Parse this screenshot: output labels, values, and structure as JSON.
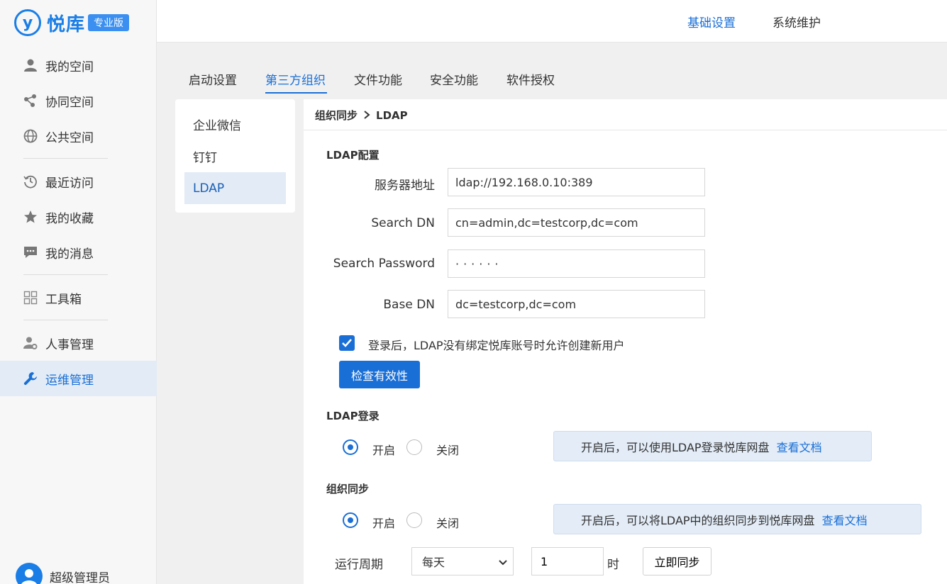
{
  "app": {
    "logo_mark": "y",
    "name": "悦库",
    "edition": "专业版"
  },
  "sidebar": {
    "items": [
      {
        "label": "我的空间",
        "icon": "user-icon"
      },
      {
        "label": "协同空间",
        "icon": "share-icon"
      },
      {
        "label": "公共空间",
        "icon": "globe-icon"
      },
      {
        "label": "最近访问",
        "icon": "history-icon"
      },
      {
        "label": "我的收藏",
        "icon": "star-icon"
      },
      {
        "label": "我的消息",
        "icon": "message-icon"
      },
      {
        "label": "工具箱",
        "icon": "grid-icon"
      },
      {
        "label": "人事管理",
        "icon": "user-gear-icon"
      },
      {
        "label": "运维管理",
        "icon": "wrench-icon"
      }
    ],
    "active_index": 8,
    "user": {
      "name": "超级管理员"
    }
  },
  "header": {
    "tabs": [
      "基础设置",
      "系统维护"
    ],
    "active_index": 0
  },
  "tabs": {
    "items": [
      "启动设置",
      "第三方组织",
      "文件功能",
      "安全功能",
      "软件授权"
    ],
    "active_index": 1
  },
  "submenu": {
    "items": [
      "企业微信",
      "钉钉",
      "LDAP"
    ],
    "active_index": 2
  },
  "breadcrumb": {
    "parent": "组织同步",
    "current": "LDAP"
  },
  "ldap_config": {
    "title": "LDAP配置",
    "server_label": "服务器地址",
    "server_value": "ldap://192.168.0.10:389",
    "search_dn_label": "Search DN",
    "search_dn_value": "cn=admin,dc=testcorp,dc=com",
    "search_password_label": "Search Password",
    "search_password_value": "······",
    "base_dn_label": "Base DN",
    "base_dn_value": "dc=testcorp,dc=com",
    "allow_create_label": "登录后，LDAP没有绑定悦库账号时允许创建新用户",
    "allow_create_checked": true,
    "check_button": "检查有效性"
  },
  "ldap_login": {
    "title": "LDAP登录",
    "on_label": "开启",
    "off_label": "关闭",
    "selected": "on",
    "info": "开启后，可以使用LDAP登录悦库网盘",
    "doc_link": "查看文档"
  },
  "org_sync": {
    "title": "组织同步",
    "on_label": "开启",
    "off_label": "关闭",
    "selected": "on",
    "info": "开启后，可以将LDAP中的组织同步到悦库网盘",
    "doc_link": "查看文档",
    "period_label": "运行周期",
    "period_value": "每天",
    "hour_value": "1",
    "hour_unit": "时",
    "sync_button": "立即同步"
  },
  "colors": {
    "accent": "#1a6fd6",
    "active_bg": "#e2ebf6",
    "info_bg": "#e3ecf7"
  }
}
